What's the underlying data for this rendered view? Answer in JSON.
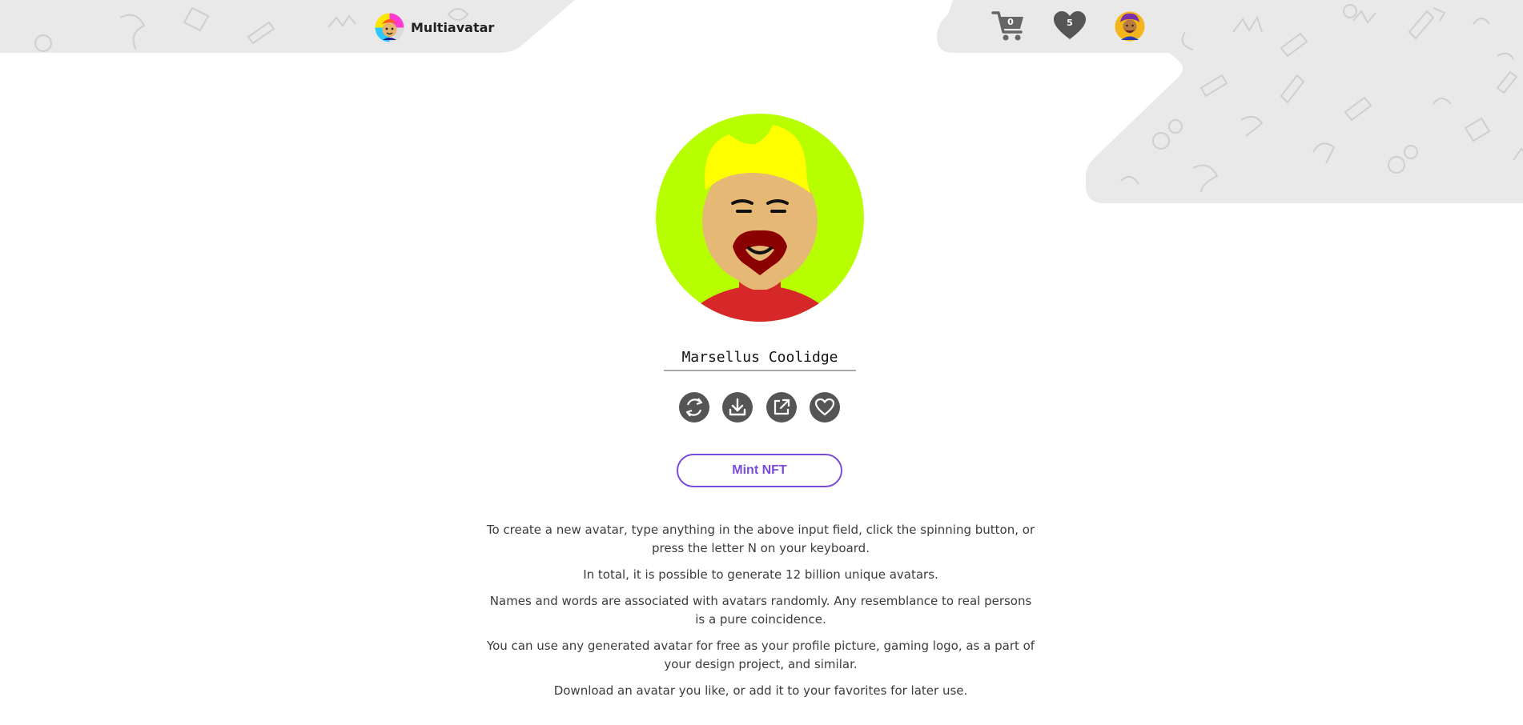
{
  "header": {
    "brand_name": "Multiavatar",
    "cart_count": "0",
    "favorites_count": "5",
    "icons": {
      "brand": "multiavatar-logo",
      "cart": "cart-icon",
      "favorites": "heart-icon",
      "user": "user-avatar"
    }
  },
  "avatar": {
    "name_value": "Marsellus Coolidge",
    "colors": {
      "background": "#b7ff00",
      "skin": "#e6b876",
      "hair": "#ffff00",
      "beard": "#8b0000",
      "shirt": "#d62828"
    }
  },
  "actions": [
    {
      "icon": "refresh-icon"
    },
    {
      "icon": "download-icon"
    },
    {
      "icon": "share-icon"
    },
    {
      "icon": "heart-icon"
    }
  ],
  "mint": {
    "label": "Mint NFT",
    "accent": "#7b4bdc"
  },
  "info": [
    "To create a new avatar, type anything in the above input field, click the spinning button, or press the letter N on your keyboard.",
    "In total, it is possible to generate 12 billion unique avatars.",
    "Names and words are associated with avatars randomly. Any resemblance to real persons is a pure coincidence.",
    "You can use any generated avatar for free as your profile picture, gaming logo, as a part of your design project, and similar.",
    "Download an avatar you like, or add it to your favorites for later use."
  ]
}
